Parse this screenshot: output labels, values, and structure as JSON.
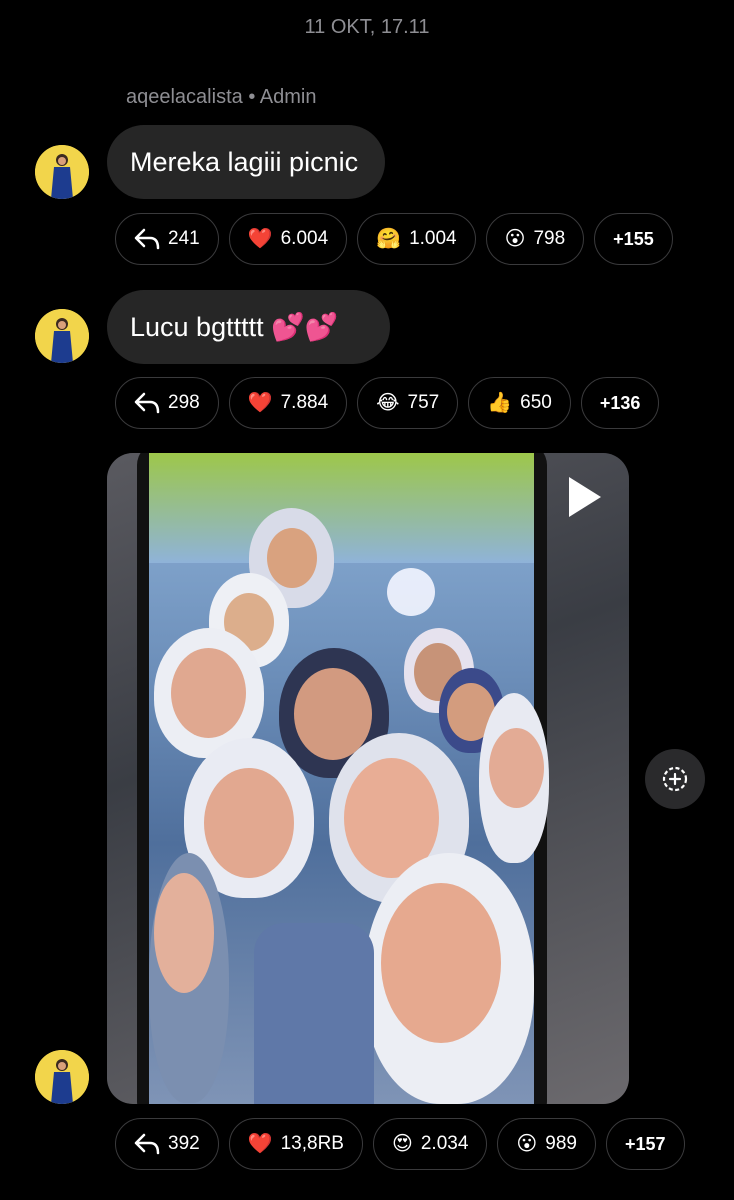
{
  "timestamp": "11 OKT, 17.11",
  "sender": {
    "name": "aqeelacalista",
    "separator": "•",
    "role": "Admin"
  },
  "messages": [
    {
      "text": "Mereka lagiii picnic",
      "reply_count": "241",
      "reactions": [
        {
          "emoji": "❤️",
          "count": "6.004"
        },
        {
          "emoji": "🤗",
          "count": "1.004"
        },
        {
          "emoji": "😮",
          "count": "798"
        }
      ],
      "more": "+155"
    },
    {
      "text": "Lucu bgttttt 💕💕",
      "reply_count": "298",
      "reactions": [
        {
          "emoji": "❤️",
          "count": "7.884"
        },
        {
          "emoji": "😂",
          "count": "757"
        },
        {
          "emoji": "👍",
          "count": "650"
        }
      ],
      "more": "+136"
    },
    {
      "media": "video",
      "reply_count": "392",
      "reactions": [
        {
          "emoji": "❤️",
          "count": "13,8RB"
        },
        {
          "emoji": "😍",
          "count": "2.034"
        },
        {
          "emoji": "😮",
          "count": "989"
        }
      ],
      "more": "+157"
    }
  ],
  "icons": {
    "reply": "reply-arrow-icon",
    "play": "play-icon",
    "save": "add-to-collection-icon"
  }
}
